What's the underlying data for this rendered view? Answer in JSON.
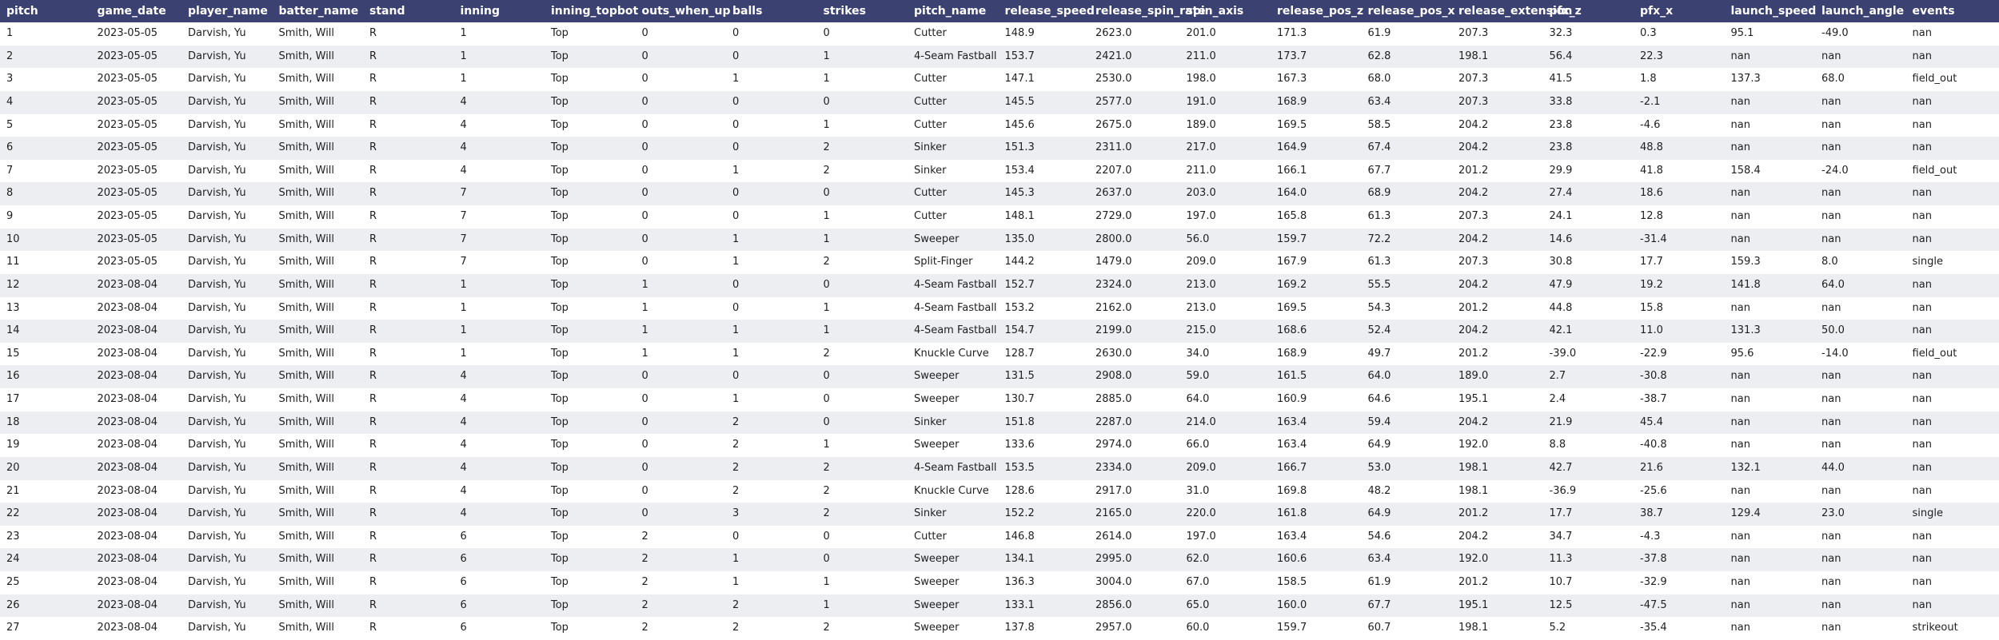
{
  "table": {
    "columns": [
      "pitch",
      "game_date",
      "player_name",
      "batter_name",
      "stand",
      "inning",
      "inning_topbot",
      "outs_when_up",
      "balls",
      "strikes",
      "pitch_name",
      "release_speed",
      "release_spin_rate",
      "spin_axis",
      "release_pos_z",
      "release_pos_x",
      "release_extension",
      "pfx_z",
      "pfx_x",
      "launch_speed",
      "launch_angle",
      "events"
    ],
    "rows": [
      [
        "1",
        "2023-05-05",
        "Darvish, Yu",
        "Smith, Will",
        "R",
        "1",
        "Top",
        "0",
        "0",
        "0",
        "Cutter",
        "148.9",
        "2623.0",
        "201.0",
        "171.3",
        "61.9",
        "207.3",
        "32.3",
        "0.3",
        "95.1",
        "-49.0",
        "nan"
      ],
      [
        "2",
        "2023-05-05",
        "Darvish, Yu",
        "Smith, Will",
        "R",
        "1",
        "Top",
        "0",
        "0",
        "1",
        "4-Seam Fastball",
        "153.7",
        "2421.0",
        "211.0",
        "173.7",
        "62.8",
        "198.1",
        "56.4",
        "22.3",
        "nan",
        "nan",
        "nan"
      ],
      [
        "3",
        "2023-05-05",
        "Darvish, Yu",
        "Smith, Will",
        "R",
        "1",
        "Top",
        "0",
        "1",
        "1",
        "Cutter",
        "147.1",
        "2530.0",
        "198.0",
        "167.3",
        "68.0",
        "207.3",
        "41.5",
        "1.8",
        "137.3",
        "68.0",
        "field_out"
      ],
      [
        "4",
        "2023-05-05",
        "Darvish, Yu",
        "Smith, Will",
        "R",
        "4",
        "Top",
        "0",
        "0",
        "0",
        "Cutter",
        "145.5",
        "2577.0",
        "191.0",
        "168.9",
        "63.4",
        "207.3",
        "33.8",
        "-2.1",
        "nan",
        "nan",
        "nan"
      ],
      [
        "5",
        "2023-05-05",
        "Darvish, Yu",
        "Smith, Will",
        "R",
        "4",
        "Top",
        "0",
        "0",
        "1",
        "Cutter",
        "145.6",
        "2675.0",
        "189.0",
        "169.5",
        "58.5",
        "204.2",
        "23.8",
        "-4.6",
        "nan",
        "nan",
        "nan"
      ],
      [
        "6",
        "2023-05-05",
        "Darvish, Yu",
        "Smith, Will",
        "R",
        "4",
        "Top",
        "0",
        "0",
        "2",
        "Sinker",
        "151.3",
        "2311.0",
        "217.0",
        "164.9",
        "67.4",
        "204.2",
        "23.8",
        "48.8",
        "nan",
        "nan",
        "nan"
      ],
      [
        "7",
        "2023-05-05",
        "Darvish, Yu",
        "Smith, Will",
        "R",
        "4",
        "Top",
        "0",
        "1",
        "2",
        "Sinker",
        "153.4",
        "2207.0",
        "211.0",
        "166.1",
        "67.7",
        "201.2",
        "29.9",
        "41.8",
        "158.4",
        "-24.0",
        "field_out"
      ],
      [
        "8",
        "2023-05-05",
        "Darvish, Yu",
        "Smith, Will",
        "R",
        "7",
        "Top",
        "0",
        "0",
        "0",
        "Cutter",
        "145.3",
        "2637.0",
        "203.0",
        "164.0",
        "68.9",
        "204.2",
        "27.4",
        "18.6",
        "nan",
        "nan",
        "nan"
      ],
      [
        "9",
        "2023-05-05",
        "Darvish, Yu",
        "Smith, Will",
        "R",
        "7",
        "Top",
        "0",
        "0",
        "1",
        "Cutter",
        "148.1",
        "2729.0",
        "197.0",
        "165.8",
        "61.3",
        "207.3",
        "24.1",
        "12.8",
        "nan",
        "nan",
        "nan"
      ],
      [
        "10",
        "2023-05-05",
        "Darvish, Yu",
        "Smith, Will",
        "R",
        "7",
        "Top",
        "0",
        "1",
        "1",
        "Sweeper",
        "135.0",
        "2800.0",
        "56.0",
        "159.7",
        "72.2",
        "204.2",
        "14.6",
        "-31.4",
        "nan",
        "nan",
        "nan"
      ],
      [
        "11",
        "2023-05-05",
        "Darvish, Yu",
        "Smith, Will",
        "R",
        "7",
        "Top",
        "0",
        "1",
        "2",
        "Split-Finger",
        "144.2",
        "1479.0",
        "209.0",
        "167.9",
        "61.3",
        "207.3",
        "30.8",
        "17.7",
        "159.3",
        "8.0",
        "single"
      ],
      [
        "12",
        "2023-08-04",
        "Darvish, Yu",
        "Smith, Will",
        "R",
        "1",
        "Top",
        "1",
        "0",
        "0",
        "4-Seam Fastball",
        "152.7",
        "2324.0",
        "213.0",
        "169.2",
        "55.5",
        "204.2",
        "47.9",
        "19.2",
        "141.8",
        "64.0",
        "nan"
      ],
      [
        "13",
        "2023-08-04",
        "Darvish, Yu",
        "Smith, Will",
        "R",
        "1",
        "Top",
        "1",
        "0",
        "1",
        "4-Seam Fastball",
        "153.2",
        "2162.0",
        "213.0",
        "169.5",
        "54.3",
        "201.2",
        "44.8",
        "15.8",
        "nan",
        "nan",
        "nan"
      ],
      [
        "14",
        "2023-08-04",
        "Darvish, Yu",
        "Smith, Will",
        "R",
        "1",
        "Top",
        "1",
        "1",
        "1",
        "4-Seam Fastball",
        "154.7",
        "2199.0",
        "215.0",
        "168.6",
        "52.4",
        "204.2",
        "42.1",
        "11.0",
        "131.3",
        "50.0",
        "nan"
      ],
      [
        "15",
        "2023-08-04",
        "Darvish, Yu",
        "Smith, Will",
        "R",
        "1",
        "Top",
        "1",
        "1",
        "2",
        "Knuckle Curve",
        "128.7",
        "2630.0",
        "34.0",
        "168.9",
        "49.7",
        "201.2",
        "-39.0",
        "-22.9",
        "95.6",
        "-14.0",
        "field_out"
      ],
      [
        "16",
        "2023-08-04",
        "Darvish, Yu",
        "Smith, Will",
        "R",
        "4",
        "Top",
        "0",
        "0",
        "0",
        "Sweeper",
        "131.5",
        "2908.0",
        "59.0",
        "161.5",
        "64.0",
        "189.0",
        "2.7",
        "-30.8",
        "nan",
        "nan",
        "nan"
      ],
      [
        "17",
        "2023-08-04",
        "Darvish, Yu",
        "Smith, Will",
        "R",
        "4",
        "Top",
        "0",
        "1",
        "0",
        "Sweeper",
        "130.7",
        "2885.0",
        "64.0",
        "160.9",
        "64.6",
        "195.1",
        "2.4",
        "-38.7",
        "nan",
        "nan",
        "nan"
      ],
      [
        "18",
        "2023-08-04",
        "Darvish, Yu",
        "Smith, Will",
        "R",
        "4",
        "Top",
        "0",
        "2",
        "0",
        "Sinker",
        "151.8",
        "2287.0",
        "214.0",
        "163.4",
        "59.4",
        "204.2",
        "21.9",
        "45.4",
        "nan",
        "nan",
        "nan"
      ],
      [
        "19",
        "2023-08-04",
        "Darvish, Yu",
        "Smith, Will",
        "R",
        "4",
        "Top",
        "0",
        "2",
        "1",
        "Sweeper",
        "133.6",
        "2974.0",
        "66.0",
        "163.4",
        "64.9",
        "192.0",
        "8.8",
        "-40.8",
        "nan",
        "nan",
        "nan"
      ],
      [
        "20",
        "2023-08-04",
        "Darvish, Yu",
        "Smith, Will",
        "R",
        "4",
        "Top",
        "0",
        "2",
        "2",
        "4-Seam Fastball",
        "153.5",
        "2334.0",
        "209.0",
        "166.7",
        "53.0",
        "198.1",
        "42.7",
        "21.6",
        "132.1",
        "44.0",
        "nan"
      ],
      [
        "21",
        "2023-08-04",
        "Darvish, Yu",
        "Smith, Will",
        "R",
        "4",
        "Top",
        "0",
        "2",
        "2",
        "Knuckle Curve",
        "128.6",
        "2917.0",
        "31.0",
        "169.8",
        "48.2",
        "198.1",
        "-36.9",
        "-25.6",
        "nan",
        "nan",
        "nan"
      ],
      [
        "22",
        "2023-08-04",
        "Darvish, Yu",
        "Smith, Will",
        "R",
        "4",
        "Top",
        "0",
        "3",
        "2",
        "Sinker",
        "152.2",
        "2165.0",
        "220.0",
        "161.8",
        "64.9",
        "201.2",
        "17.7",
        "38.7",
        "129.4",
        "23.0",
        "single"
      ],
      [
        "23",
        "2023-08-04",
        "Darvish, Yu",
        "Smith, Will",
        "R",
        "6",
        "Top",
        "2",
        "0",
        "0",
        "Cutter",
        "146.8",
        "2614.0",
        "197.0",
        "163.4",
        "54.6",
        "204.2",
        "34.7",
        "-4.3",
        "nan",
        "nan",
        "nan"
      ],
      [
        "24",
        "2023-08-04",
        "Darvish, Yu",
        "Smith, Will",
        "R",
        "6",
        "Top",
        "2",
        "1",
        "0",
        "Sweeper",
        "134.1",
        "2995.0",
        "62.0",
        "160.6",
        "63.4",
        "192.0",
        "11.3",
        "-37.8",
        "nan",
        "nan",
        "nan"
      ],
      [
        "25",
        "2023-08-04",
        "Darvish, Yu",
        "Smith, Will",
        "R",
        "6",
        "Top",
        "2",
        "1",
        "1",
        "Sweeper",
        "136.3",
        "3004.0",
        "67.0",
        "158.5",
        "61.9",
        "201.2",
        "10.7",
        "-32.9",
        "nan",
        "nan",
        "nan"
      ],
      [
        "26",
        "2023-08-04",
        "Darvish, Yu",
        "Smith, Will",
        "R",
        "6",
        "Top",
        "2",
        "2",
        "1",
        "Sweeper",
        "133.1",
        "2856.0",
        "65.0",
        "160.0",
        "67.7",
        "195.1",
        "12.5",
        "-47.5",
        "nan",
        "nan",
        "nan"
      ],
      [
        "27",
        "2023-08-04",
        "Darvish, Yu",
        "Smith, Will",
        "R",
        "6",
        "Top",
        "2",
        "2",
        "2",
        "Sweeper",
        "137.8",
        "2957.0",
        "60.0",
        "159.7",
        "60.7",
        "198.1",
        "5.2",
        "-35.4",
        "nan",
        "nan",
        "strikeout"
      ]
    ]
  }
}
